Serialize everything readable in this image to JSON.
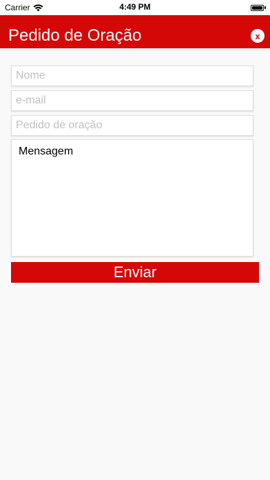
{
  "status_bar": {
    "carrier": "Carrier",
    "time": "4:49 PM",
    "wifi_icon": "wifi-icon",
    "battery_icon": "battery-icon"
  },
  "header": {
    "title": "Pedido de Oração",
    "close_label": "x",
    "background_color": "#d50808"
  },
  "form": {
    "name_placeholder": "Nome",
    "email_placeholder": "e-mail",
    "request_placeholder": "Pedido de oração",
    "message_value": "Mensagem",
    "send_label": "Enviar"
  }
}
